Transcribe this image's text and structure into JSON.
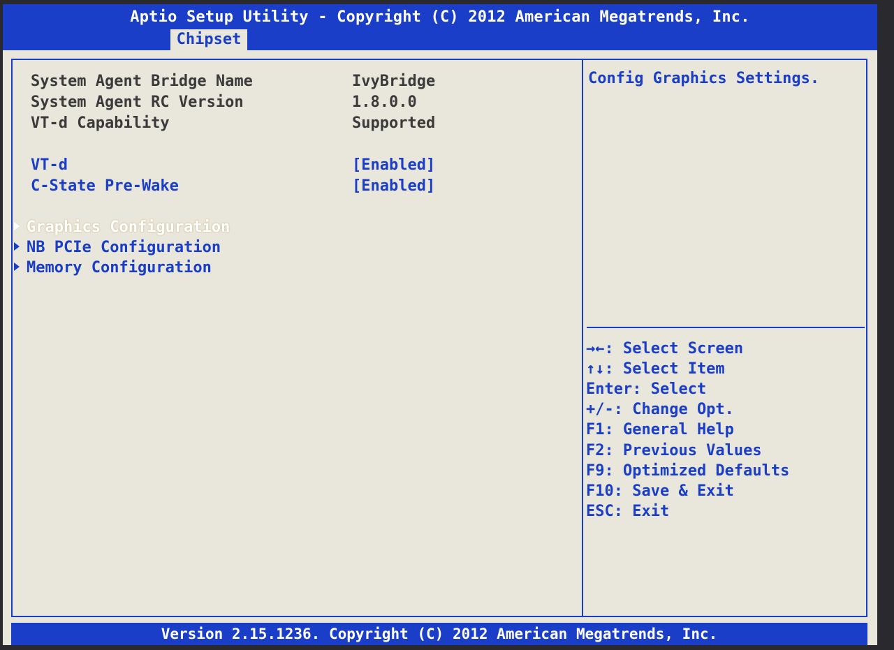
{
  "header": {
    "title": "Aptio Setup Utility - Copyright (C) 2012 American Megatrends, Inc.",
    "active_tab": "Chipset"
  },
  "main": {
    "info": [
      {
        "label": "System Agent Bridge Name",
        "value": "IvyBridge"
      },
      {
        "label": "System Agent RC Version",
        "value": "1.8.0.0"
      },
      {
        "label": "VT-d Capability",
        "value": "Supported"
      }
    ],
    "settings": [
      {
        "label": "VT-d",
        "value": "[Enabled]"
      },
      {
        "label": "C-State Pre-Wake",
        "value": "[Enabled]"
      }
    ],
    "submenus": [
      {
        "label": "Graphics Configuration",
        "selected": true
      },
      {
        "label": "NB PCIe Configuration",
        "selected": false
      },
      {
        "label": "Memory Configuration",
        "selected": false
      }
    ]
  },
  "help": {
    "description": "Config Graphics Settings.",
    "keys": [
      "→←: Select Screen",
      "↑↓: Select Item",
      "Enter: Select",
      "+/-: Change Opt.",
      "F1: General Help",
      "F2: Previous Values",
      "F9: Optimized Defaults",
      "F10: Save & Exit",
      "ESC: Exit"
    ]
  },
  "footer": {
    "text": "Version 2.15.1236. Copyright (C) 2012 American Megatrends, Inc."
  }
}
